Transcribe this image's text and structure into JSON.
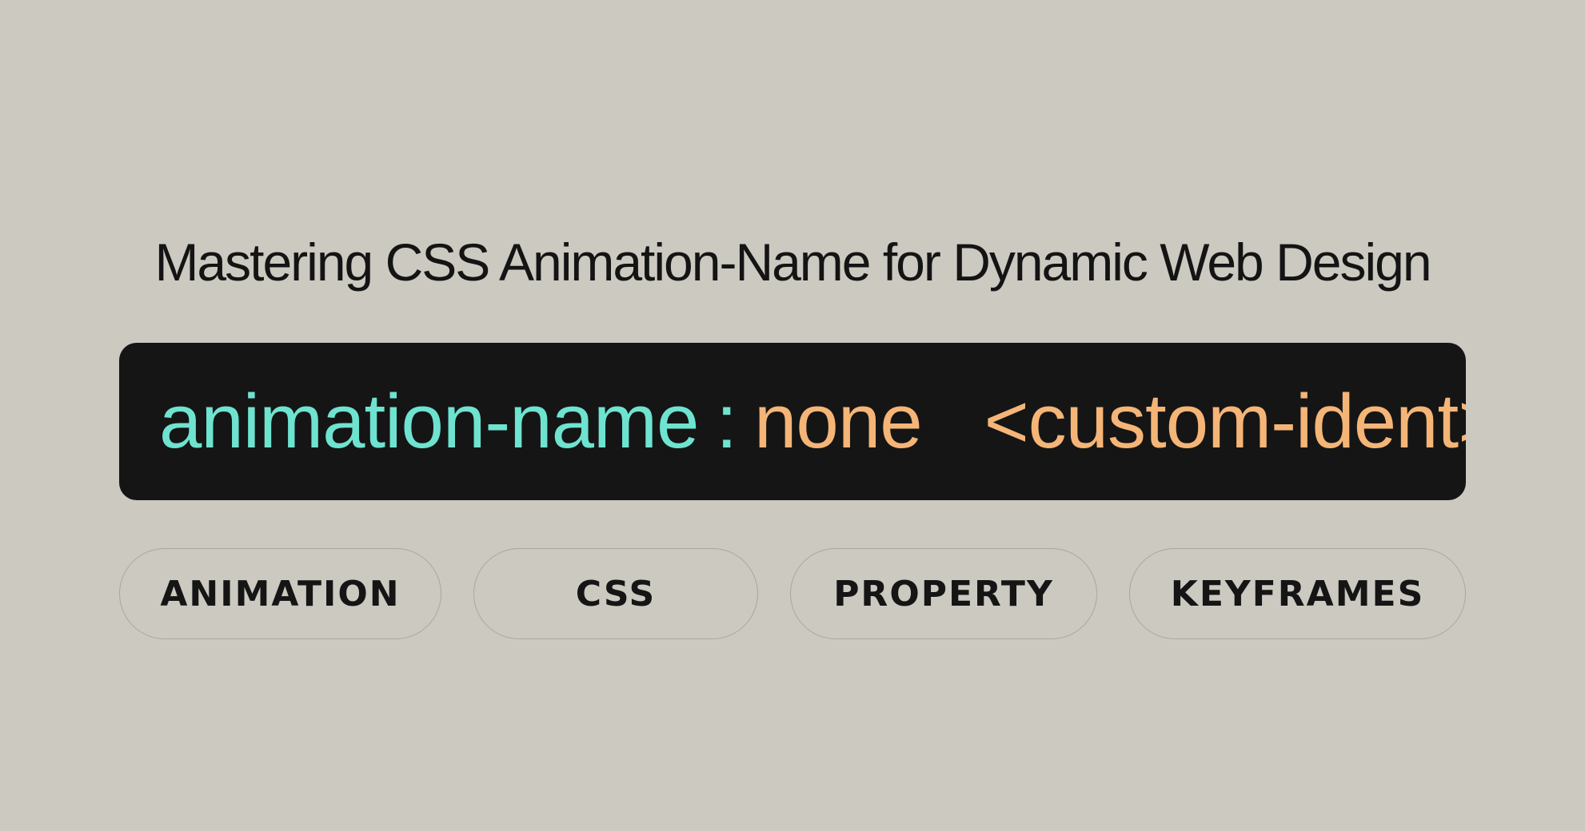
{
  "title": "Mastering CSS Animation-Name for Dynamic Web Design",
  "code": {
    "property": "animation-name",
    "colon": ":",
    "value_1": "none",
    "value_2": "<custom-ident>",
    "colors": {
      "property": "#6ee3d0",
      "value": "#f4b577",
      "background": "#151515"
    }
  },
  "tags": [
    {
      "label": "ANIMATION"
    },
    {
      "label": "CSS"
    },
    {
      "label": "PROPERTY"
    },
    {
      "label": "KEYFRAMES"
    }
  ],
  "colors": {
    "page_background": "#cbc9c0",
    "text": "#141414"
  }
}
